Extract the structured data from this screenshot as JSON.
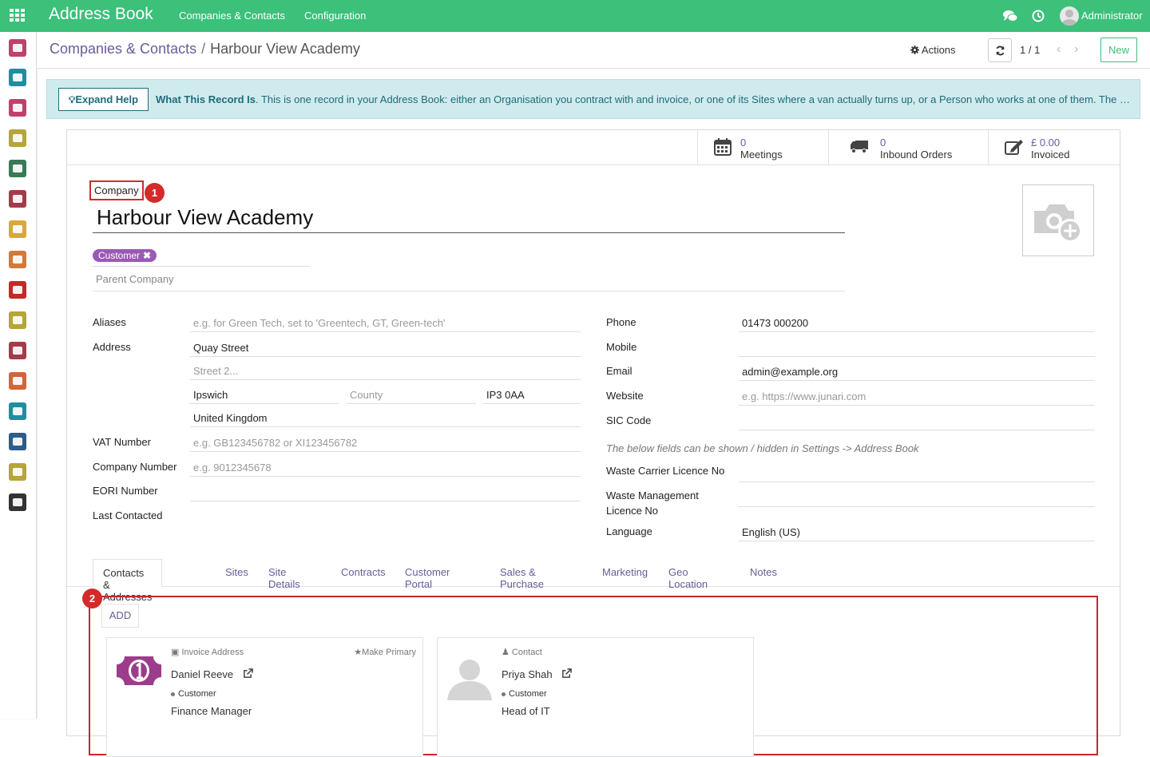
{
  "topbar": {
    "app_title": "Address Book",
    "menu": [
      "Companies & Contacts",
      "Configuration"
    ],
    "user": "Administrator"
  },
  "sidebar": {
    "icons": [
      {
        "name": "dashboard",
        "color": "#c0416a"
      },
      {
        "name": "contacts",
        "color": "#1e8ea0"
      },
      {
        "name": "discuss",
        "color": "#c0416a"
      },
      {
        "name": "calendar",
        "color": "#b5a53b"
      },
      {
        "name": "inventory",
        "color": "#3a7a57"
      },
      {
        "name": "boxes",
        "color": "#a33c4a"
      },
      {
        "name": "packages",
        "color": "#d8a93a"
      },
      {
        "name": "invoicing",
        "color": "#d17a3a"
      },
      {
        "name": "marketing",
        "color": "#c62828"
      },
      {
        "name": "documents",
        "color": "#b5a53b"
      },
      {
        "name": "delivery",
        "color": "#a33c4a"
      },
      {
        "name": "website",
        "color": "#d1663a"
      },
      {
        "name": "employees",
        "color": "#1e8ea0"
      },
      {
        "name": "fleet",
        "color": "#2c5c8a"
      },
      {
        "name": "user-settings",
        "color": "#b5a53b"
      },
      {
        "name": "settings",
        "color": "#333333"
      }
    ]
  },
  "control": {
    "breadcrumb_parent": "Companies & Contacts",
    "breadcrumb_separator": "/",
    "breadcrumb_current": "Harbour View Academy",
    "actions_label": "Actions",
    "pager": "1 / 1",
    "new_label": "New"
  },
  "help": {
    "button_label": "Expand Help",
    "title": "What This Record Is",
    "text": ". This is one record in your Address Book: either an Organisation you contract with and invoice, or one of its Sites where a van actually turns up, or a Person who works at one of them. The buttons ..."
  },
  "stats": [
    {
      "value": "0",
      "label": "Meetings",
      "icon": "calendar-icon"
    },
    {
      "value": "0",
      "label": "Inbound Orders",
      "icon": "truck-icon"
    },
    {
      "value": "£ 0.00",
      "label": "Invoiced",
      "icon": "edit-icon"
    }
  ],
  "record": {
    "type_label": "Company",
    "name": "Harbour View Academy",
    "tag": "Customer",
    "parent_placeholder": "Parent Company"
  },
  "markers": [
    "1",
    "2"
  ],
  "left_fields": {
    "aliases_label": "Aliases",
    "aliases_placeholder": "e.g. for Green Tech, set to 'Greentech, GT, Green-tech'",
    "address_label": "Address",
    "street": "Quay Street",
    "street2_placeholder": "Street 2...",
    "city": "Ipswich",
    "county_placeholder": "County",
    "postcode": "IP3 0AA",
    "country": "United Kingdom",
    "vat_label": "VAT Number",
    "vat_placeholder": "e.g. GB123456782 or XI123456782",
    "company_number_label": "Company Number",
    "company_number_placeholder": "e.g. 9012345678",
    "eori_label": "EORI Number",
    "last_contacted_label": "Last Contacted"
  },
  "right_fields": {
    "phone_label": "Phone",
    "phone": "01473 000200",
    "mobile_label": "Mobile",
    "email_label": "Email",
    "email": "admin@example.org",
    "website_label": "Website",
    "website_placeholder": "e.g. https://www.junari.com",
    "sic_label": "SIC Code",
    "settings_note": "The below fields can be shown / hidden in Settings -> Address Book",
    "waste_carrier_label": "Waste Carrier Licence No",
    "waste_mgmt_label_1": "Waste Management",
    "waste_mgmt_label_2": "Licence No",
    "language_label": "Language",
    "language": "English (US)"
  },
  "tabs": [
    "Contacts & Addresses",
    "Sites",
    "Site Details",
    "Contracts",
    "Customer Portal",
    "Sales & Purchase",
    "Marketing",
    "Geo Location",
    "Notes"
  ],
  "contacts": {
    "add_label": "ADD",
    "cards": [
      {
        "kind": "Invoice Address",
        "action": "Make Primary",
        "name": "Daniel Reeve",
        "tag": "Customer",
        "job": "Finance Manager"
      },
      {
        "kind": "Contact",
        "action": "",
        "name": "Priya Shah",
        "tag": "Customer",
        "job": "Head of IT"
      }
    ]
  }
}
